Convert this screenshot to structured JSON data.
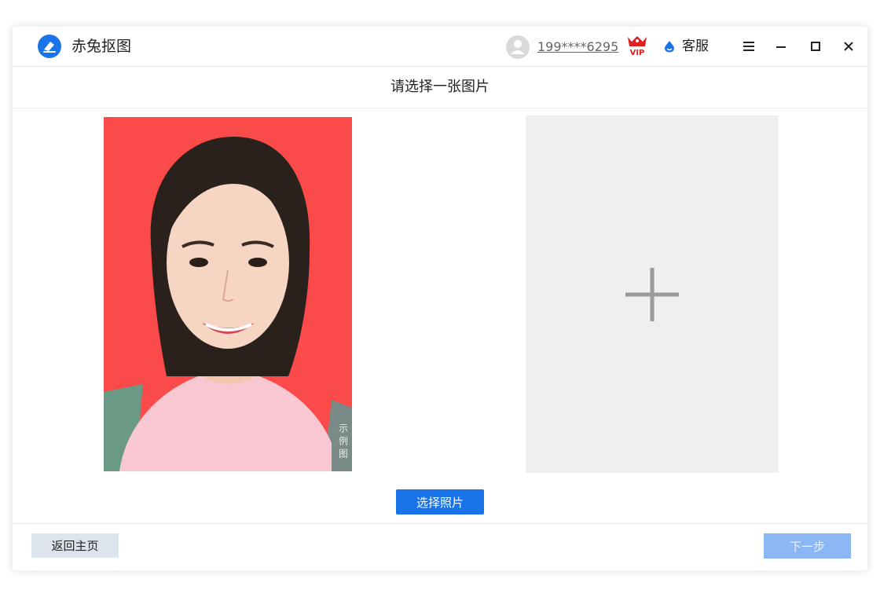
{
  "app": {
    "title": "赤兔抠图",
    "accent_color": "#1a73e8"
  },
  "header": {
    "phone": "199****6295",
    "service_label": "客服",
    "icons": [
      "avatar-icon",
      "vip-crown-icon",
      "service-drop-icon",
      "menu-icon",
      "minimize-icon",
      "maximize-icon",
      "close-icon"
    ]
  },
  "main": {
    "subtitle": "请选择一张图片",
    "sample_tag": "示例图",
    "upload_icon": "plus-icon",
    "select_button": "选择照片"
  },
  "footer": {
    "home_button": "返回主页",
    "next_button": "下一步"
  }
}
